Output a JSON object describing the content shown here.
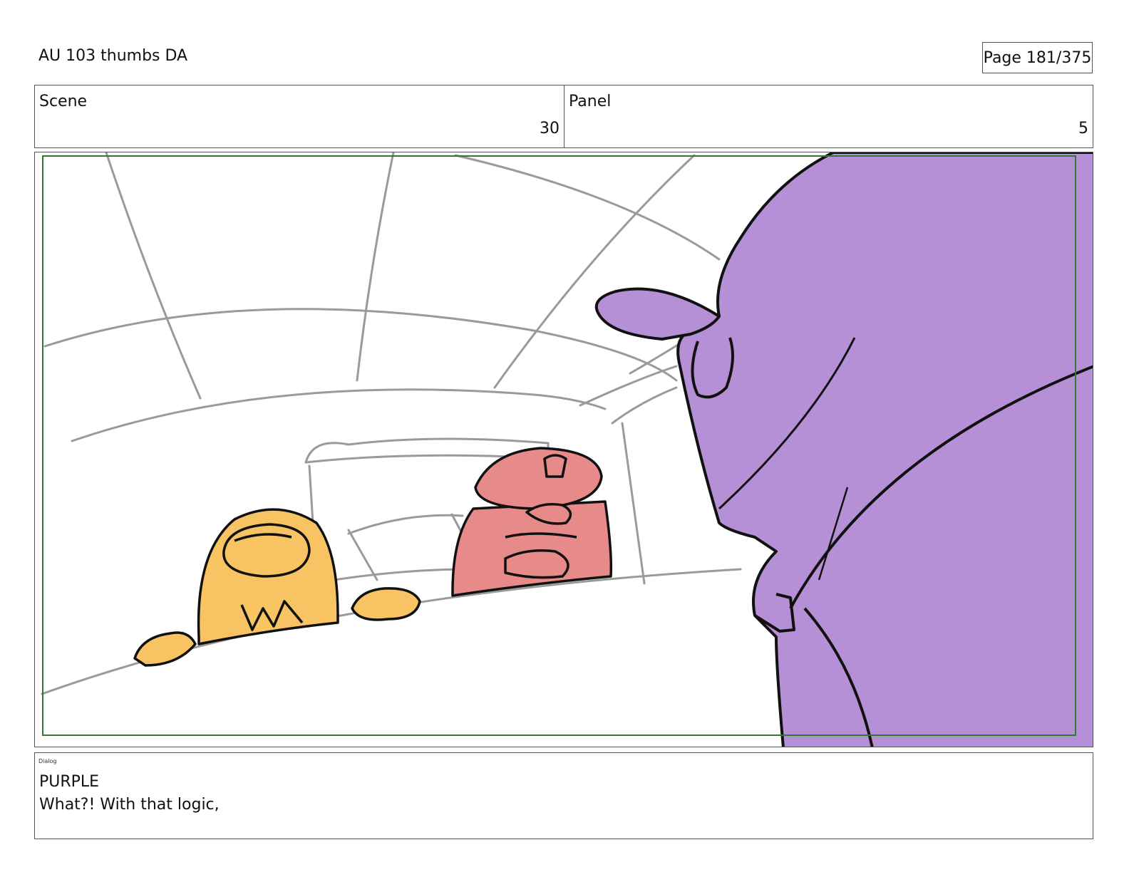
{
  "header": {
    "title": "AU 103 thumbs DA",
    "page": "Page 181/375"
  },
  "info": {
    "scene_label": "Scene",
    "scene_value": "30",
    "panel_label": "Panel",
    "panel_value": "5"
  },
  "dialog": {
    "label": "Dialog",
    "speaker": "PURPLE",
    "line": "What?! With that logic,"
  },
  "colors": {
    "safe_frame": "#2f7a2f",
    "purple_character": "#b690d6",
    "yellow_character": "#f8c463",
    "red_character": "#e68a8a",
    "background_lines": "#9a9a9a"
  }
}
